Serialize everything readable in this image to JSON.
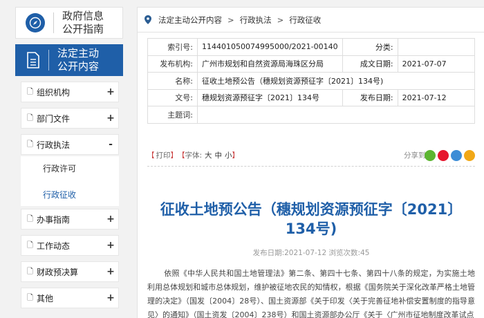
{
  "guide": {
    "title_line1": "政府信息",
    "title_line2": "公开指南"
  },
  "legal": {
    "title_line1": "法定主动",
    "title_line2": "公开内容"
  },
  "menu": [
    {
      "label": "组织机构",
      "toggle": "+"
    },
    {
      "label": "部门文件",
      "toggle": "+"
    },
    {
      "label": "行政执法",
      "toggle": "-"
    },
    {
      "label": "办事指南",
      "toggle": "+"
    },
    {
      "label": "工作动态",
      "toggle": "+"
    },
    {
      "label": "财政预决算",
      "toggle": "+"
    },
    {
      "label": "其他",
      "toggle": "+"
    }
  ],
  "submenu": [
    {
      "label": "行政许可"
    },
    {
      "label": "行政征收"
    }
  ],
  "breadcrumb": {
    "items": [
      "法定主动公开内容",
      "行政执法",
      "行政征收"
    ],
    "sep": ">"
  },
  "meta": {
    "index_label": "索引号:",
    "index_value": "114401050074995000/2021-00140",
    "category_label": "分类:",
    "category_value": "",
    "org_label": "发布机构:",
    "org_value": "广州市规划和自然资源局海珠区分局",
    "date_label": "成文日期:",
    "date_value": "2021-07-07",
    "name_label": "名称:",
    "name_value": "征收土地预公告（穗规划资源预征字〔2021〕134号)",
    "docno_label": "文号:",
    "docno_value": "穗规划资源预征字〔2021〕134号",
    "pubdate_label": "发布日期:",
    "pubdate_value": "2021-07-12",
    "keywords_label": "主题词:",
    "keywords_value": ""
  },
  "toolbar": {
    "print": "打印",
    "font_label": "字体:",
    "big": "大",
    "mid": "中",
    "small": "小",
    "share_label": "分享到:",
    "bracket_open": "【",
    "bracket_close": "】"
  },
  "share_icons": [
    {
      "name": "wechat-icon",
      "color": "#5cb531"
    },
    {
      "name": "weibo-icon",
      "color": "#e6162d"
    },
    {
      "name": "qzone-icon",
      "color": "#3d8dd6"
    },
    {
      "name": "qq-icon",
      "color": "#f1a817"
    }
  ],
  "article": {
    "title": "征收土地预公告（穗规划资源预征字〔2021〕134号)",
    "pub_label": "发布日期:",
    "pub_date": "2021-07-12",
    "views_label": "浏览次数:",
    "views": "45",
    "body": "依照《中华人民共和国土地管理法》第二条、第四十七条、第四十八条的规定，为实施土地利用总体规划和城市总体规划，维护被征地农民的知情权，根据《国务院关于深化改革严格土地管理的决定》（国发〔2004〕28号）、国土资源部《关于印发〈关于完善征地补偿安置制度的指导意见〉的通知》（国土资发〔2004〕238号）和国土资源部办公厅《关于〈广州市征地制度改革试点"
  }
}
